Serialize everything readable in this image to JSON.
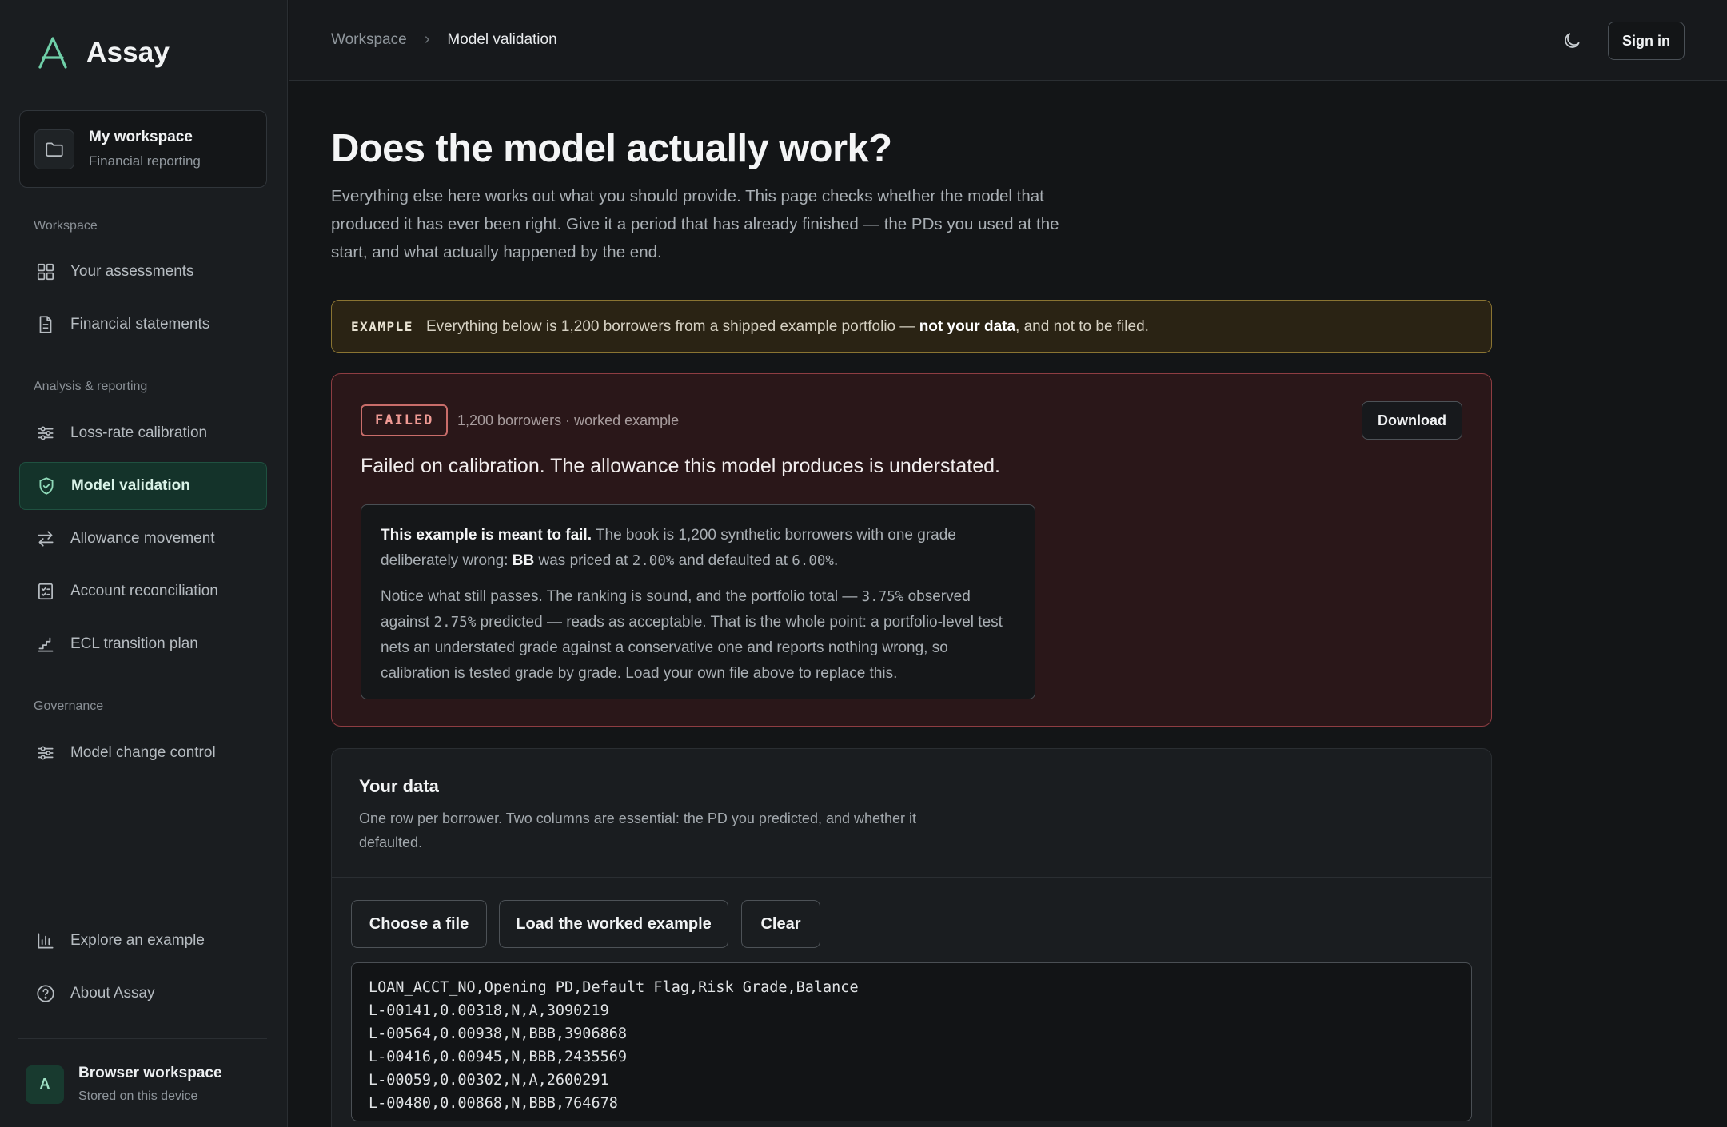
{
  "app": {
    "name": "Assay"
  },
  "workspace_card": {
    "title": "My workspace",
    "subtitle": "Financial reporting"
  },
  "sidebar": {
    "sections": [
      {
        "label": "Workspace"
      },
      {
        "label": "Analysis & reporting"
      },
      {
        "label": "Governance"
      }
    ],
    "items": [
      {
        "label": "Your assessments",
        "icon": "grid-icon"
      },
      {
        "label": "Financial statements",
        "icon": "document-icon"
      },
      {
        "label": "Loss-rate calibration",
        "icon": "sliders-icon"
      },
      {
        "label": "Model validation",
        "icon": "shield-check-icon",
        "active": true
      },
      {
        "label": "Allowance movement",
        "icon": "arrows-swap-icon"
      },
      {
        "label": "Account reconciliation",
        "icon": "checklist-icon"
      },
      {
        "label": "ECL transition plan",
        "icon": "stairs-chart-icon"
      },
      {
        "label": "Model change control",
        "icon": "sliders-icon"
      },
      {
        "label": "Explore an example",
        "icon": "bar-chart-icon"
      },
      {
        "label": "About Assay",
        "icon": "help-circle-icon"
      }
    ],
    "user": {
      "avatar": "A",
      "name": "Browser workspace",
      "subtitle": "Stored on this device"
    }
  },
  "topbar": {
    "breadcrumb": [
      "Workspace",
      "Model validation"
    ],
    "separator": "›",
    "sign_in": "Sign in"
  },
  "page": {
    "title": "Does the model actually work?",
    "intro": "Everything else here works out what you should provide. This page checks whether the model that produced it has ever been right. Give it a period that has already finished — the PDs you used at the start, and what actually happened by the end."
  },
  "example_banner": {
    "tag": "EXAMPLE",
    "text_before": "Everything below is 1,200 borrowers from a shipped example portfolio — ",
    "text_bold": "not your data",
    "text_after": ", and not to be filed."
  },
  "result": {
    "status": "FAILED",
    "meta": "1,200 borrowers · worked example",
    "download": "Download",
    "headline": "Failed on calibration. The allowance this model produces is understated.",
    "note": {
      "p1_lead": "This example is meant to fail.",
      "p1_text": " The book is 1,200 synthetic borrowers with one grade deliberately wrong: ",
      "p1_grade": "BB",
      "p1_mid": " was priced at ",
      "p1_priced": "2.00%",
      "p1_mid2": " and defaulted at ",
      "p1_defaulted": "6.00%",
      "p1_end": ".",
      "p2_a": "Notice what still passes. The ranking is sound, and the portfolio total — ",
      "p2_observed": "3.75%",
      "p2_b": " observed against ",
      "p2_predicted": "2.75%",
      "p2_c": " predicted — reads as acceptable. That is the whole point: a portfolio-level test nets an understated grade against a conservative one and reports nothing wrong, so calibration is tested grade by grade. Load your own file above to replace this."
    }
  },
  "data_section": {
    "title": "Your data",
    "description": "One row per borrower. Two columns are essential: the PD you predicted, and whether it defaulted.",
    "buttons": {
      "choose": "Choose a file",
      "load": "Load the worked example",
      "clear": "Clear"
    },
    "csv": "LOAN_ACCT_NO,Opening PD,Default Flag,Risk Grade,Balance\nL-00141,0.00318,N,A,3090219\nL-00564,0.00938,N,BBB,3906868\nL-00416,0.00945,N,BBB,2435569\nL-00059,0.00302,N,A,2600291\nL-00480,0.00868,N,BBB,764678"
  },
  "colors": {
    "accent": "#6fcfa8",
    "danger": "#ef9a94",
    "warning_border": "#8a7432",
    "background": "#131517"
  }
}
